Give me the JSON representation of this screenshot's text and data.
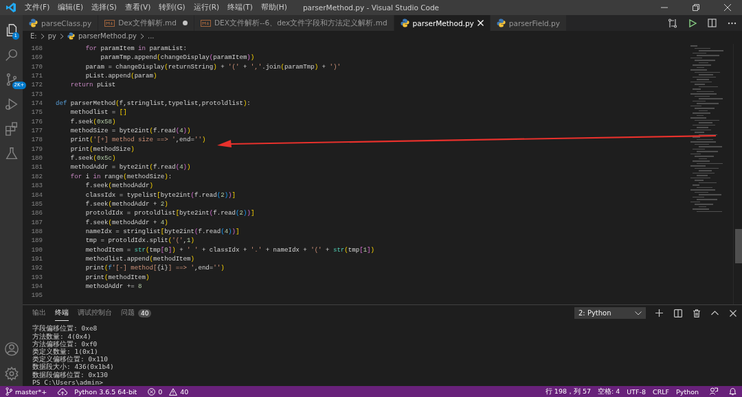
{
  "window": {
    "title": "parserMethod.py - Visual Studio Code"
  },
  "menu": [
    "文件(F)",
    "编辑(E)",
    "选择(S)",
    "查看(V)",
    "转到(G)",
    "运行(R)",
    "终端(T)",
    "帮助(H)"
  ],
  "activity_bar": [
    {
      "kind": "explorer",
      "badge": "1"
    },
    {
      "kind": "search"
    },
    {
      "kind": "source-control",
      "badge": "2K+"
    },
    {
      "kind": "run"
    },
    {
      "kind": "extensions"
    },
    {
      "kind": "testing"
    }
  ],
  "tabs": [
    {
      "label": "parseClass.py",
      "kind": "python",
      "selected": false,
      "modified": false
    },
    {
      "label": "Dex文件解析.md",
      "kind": "markdown",
      "selected": false,
      "modified": true
    },
    {
      "label": "DEX文件解析--6、dex文件字段和方法定义解析.md",
      "kind": "markdown",
      "selected": false,
      "modified": false
    },
    {
      "label": "parserMethod.py",
      "kind": "python",
      "selected": true,
      "modified": false
    },
    {
      "label": "parserField.py",
      "kind": "python",
      "selected": false,
      "modified": false
    }
  ],
  "breadcrumbs": [
    {
      "text": "E:",
      "kind": "folder"
    },
    {
      "text": "py",
      "kind": "folder"
    },
    {
      "text": "parserMethod.py",
      "kind": "python"
    },
    {
      "text": "...",
      "kind": "symbol"
    }
  ],
  "editor": {
    "lines": [
      {
        "number": "168",
        "tokens": [
          {
            "kind": "control",
            "text": "        for"
          },
          {
            "kind": "plain",
            "text": " paramItem "
          },
          {
            "kind": "control",
            "text": "in"
          },
          {
            "kind": "plain",
            "text": " paramList:"
          }
        ]
      },
      {
        "number": "169",
        "tokens": [
          {
            "kind": "plain",
            "text": "            paramTmp.append"
          },
          {
            "kind": "paren1",
            "text": "("
          },
          {
            "kind": "plain",
            "text": "changeDisplay"
          },
          {
            "kind": "paren2",
            "text": "("
          },
          {
            "kind": "plain",
            "text": "paramItem"
          },
          {
            "kind": "paren2",
            "text": ")"
          },
          {
            "kind": "paren1",
            "text": ")"
          }
        ]
      },
      {
        "number": "170",
        "tokens": [
          {
            "kind": "plain",
            "text": "        param = changeDisplay"
          },
          {
            "kind": "paren1",
            "text": "("
          },
          {
            "kind": "plain",
            "text": "returnString"
          },
          {
            "kind": "paren1",
            "text": ")"
          },
          {
            "kind": "plain",
            "text": " + "
          },
          {
            "kind": "string",
            "text": "'('"
          },
          {
            "kind": "plain",
            "text": " + "
          },
          {
            "kind": "string",
            "text": "','"
          },
          {
            "kind": "plain",
            "text": ".join"
          },
          {
            "kind": "paren1",
            "text": "("
          },
          {
            "kind": "plain",
            "text": "paramTmp"
          },
          {
            "kind": "paren1",
            "text": ")"
          },
          {
            "kind": "plain",
            "text": " + "
          },
          {
            "kind": "string",
            "text": "')'"
          }
        ]
      },
      {
        "number": "171",
        "tokens": [
          {
            "kind": "plain",
            "text": "        pList.append"
          },
          {
            "kind": "paren1",
            "text": "("
          },
          {
            "kind": "plain",
            "text": "param"
          },
          {
            "kind": "paren1",
            "text": ")"
          }
        ]
      },
      {
        "number": "172",
        "tokens": [
          {
            "kind": "control",
            "text": "    return"
          },
          {
            "kind": "plain",
            "text": " pList"
          }
        ]
      },
      {
        "number": "173"
      },
      {
        "number": "174",
        "tokens": [
          {
            "kind": "storage",
            "text": "def"
          },
          {
            "kind": "plain",
            "text": " parserMethod"
          },
          {
            "kind": "paren1",
            "text": "("
          },
          {
            "kind": "plain",
            "text": "f,stringlist,typelist,protoldlist"
          },
          {
            "kind": "paren1",
            "text": ")"
          },
          {
            "kind": "plain",
            "text": ":"
          }
        ]
      },
      {
        "number": "175",
        "tokens": [
          {
            "kind": "plain",
            "text": "    methodlist = "
          },
          {
            "kind": "paren1",
            "text": "[]"
          }
        ]
      },
      {
        "number": "176",
        "tokens": [
          {
            "kind": "plain",
            "text": "    f.seek"
          },
          {
            "kind": "paren1",
            "text": "("
          },
          {
            "kind": "number",
            "text": "0x58"
          },
          {
            "kind": "paren1",
            "text": ")"
          }
        ]
      },
      {
        "number": "177",
        "tokens": [
          {
            "kind": "plain",
            "text": "    methodSize = byte2int"
          },
          {
            "kind": "paren1",
            "text": "("
          },
          {
            "kind": "plain",
            "text": "f.read"
          },
          {
            "kind": "paren2",
            "text": "("
          },
          {
            "kind": "number",
            "text": "4"
          },
          {
            "kind": "paren2",
            "text": ")"
          },
          {
            "kind": "paren1",
            "text": ")"
          }
        ]
      },
      {
        "number": "178",
        "tokens": [
          {
            "kind": "plain",
            "text": "    print"
          },
          {
            "kind": "paren1",
            "text": "("
          },
          {
            "kind": "string",
            "text": "'[+] method size ==> '"
          },
          {
            "kind": "plain",
            "text": ",end="
          },
          {
            "kind": "string",
            "text": "''"
          },
          {
            "kind": "paren1",
            "text": ")"
          }
        ]
      },
      {
        "number": "179",
        "tokens": [
          {
            "kind": "plain",
            "text": "    print"
          },
          {
            "kind": "paren1",
            "text": "("
          },
          {
            "kind": "plain",
            "text": "methodSize"
          },
          {
            "kind": "paren1",
            "text": ")"
          }
        ]
      },
      {
        "number": "180",
        "tokens": [
          {
            "kind": "plain",
            "text": "    f.seek"
          },
          {
            "kind": "paren1",
            "text": "("
          },
          {
            "kind": "number",
            "text": "0x5c"
          },
          {
            "kind": "paren1",
            "text": ")"
          }
        ]
      },
      {
        "number": "181",
        "tokens": [
          {
            "kind": "plain",
            "text": "    methodAddr = byte2int"
          },
          {
            "kind": "paren1",
            "text": "("
          },
          {
            "kind": "plain",
            "text": "f.read"
          },
          {
            "kind": "paren2",
            "text": "("
          },
          {
            "kind": "number",
            "text": "4"
          },
          {
            "kind": "paren2",
            "text": ")"
          },
          {
            "kind": "paren1",
            "text": ")"
          }
        ]
      },
      {
        "number": "182",
        "tokens": [
          {
            "kind": "control",
            "text": "    for"
          },
          {
            "kind": "plain",
            "text": " i "
          },
          {
            "kind": "control",
            "text": "in"
          },
          {
            "kind": "plain",
            "text": " range"
          },
          {
            "kind": "paren1",
            "text": "("
          },
          {
            "kind": "plain",
            "text": "methodSize"
          },
          {
            "kind": "paren1",
            "text": ")"
          },
          {
            "kind": "plain",
            "text": ":"
          }
        ]
      },
      {
        "number": "183",
        "tokens": [
          {
            "kind": "plain",
            "text": "        f.seek"
          },
          {
            "kind": "paren1",
            "text": "("
          },
          {
            "kind": "plain",
            "text": "methodAddr"
          },
          {
            "kind": "paren1",
            "text": ")"
          }
        ]
      },
      {
        "number": "184",
        "tokens": [
          {
            "kind": "plain",
            "text": "        classIdx = typelist"
          },
          {
            "kind": "paren1",
            "text": "["
          },
          {
            "kind": "plain",
            "text": "byte2int"
          },
          {
            "kind": "paren2",
            "text": "("
          },
          {
            "kind": "plain",
            "text": "f.read"
          },
          {
            "kind": "paren3",
            "text": "("
          },
          {
            "kind": "number",
            "text": "2"
          },
          {
            "kind": "paren3",
            "text": ")"
          },
          {
            "kind": "paren2",
            "text": ")"
          },
          {
            "kind": "paren1",
            "text": "]"
          }
        ]
      },
      {
        "number": "185",
        "tokens": [
          {
            "kind": "plain",
            "text": "        f.seek"
          },
          {
            "kind": "paren1",
            "text": "("
          },
          {
            "kind": "plain",
            "text": "methodAddr + "
          },
          {
            "kind": "number",
            "text": "2"
          },
          {
            "kind": "paren1",
            "text": ")"
          }
        ]
      },
      {
        "number": "186",
        "tokens": [
          {
            "kind": "plain",
            "text": "        protoldIdx = protoldlist"
          },
          {
            "kind": "paren1",
            "text": "["
          },
          {
            "kind": "plain",
            "text": "byte2int"
          },
          {
            "kind": "paren2",
            "text": "("
          },
          {
            "kind": "plain",
            "text": "f.read"
          },
          {
            "kind": "paren3",
            "text": "("
          },
          {
            "kind": "number",
            "text": "2"
          },
          {
            "kind": "paren3",
            "text": ")"
          },
          {
            "kind": "paren2",
            "text": ")"
          },
          {
            "kind": "paren1",
            "text": "]"
          }
        ]
      },
      {
        "number": "187",
        "tokens": [
          {
            "kind": "plain",
            "text": "        f.seek"
          },
          {
            "kind": "paren1",
            "text": "("
          },
          {
            "kind": "plain",
            "text": "methodAddr + "
          },
          {
            "kind": "number",
            "text": "4"
          },
          {
            "kind": "paren1",
            "text": ")"
          }
        ]
      },
      {
        "number": "188",
        "tokens": [
          {
            "kind": "plain",
            "text": "        nameIdx = stringlist"
          },
          {
            "kind": "paren1",
            "text": "["
          },
          {
            "kind": "plain",
            "text": "byte2int"
          },
          {
            "kind": "paren2",
            "text": "("
          },
          {
            "kind": "plain",
            "text": "f.read"
          },
          {
            "kind": "paren3",
            "text": "("
          },
          {
            "kind": "number",
            "text": "4"
          },
          {
            "kind": "paren3",
            "text": ")"
          },
          {
            "kind": "paren2",
            "text": ")"
          },
          {
            "kind": "paren1",
            "text": "]"
          }
        ]
      },
      {
        "number": "189",
        "tokens": [
          {
            "kind": "plain",
            "text": "        tmp = protoldIdx.split"
          },
          {
            "kind": "paren1",
            "text": "("
          },
          {
            "kind": "string",
            "text": "'('"
          },
          {
            "kind": "plain",
            "text": ","
          },
          {
            "kind": "number",
            "text": "1"
          },
          {
            "kind": "paren1",
            "text": ")"
          }
        ]
      },
      {
        "number": "190",
        "tokens": [
          {
            "kind": "plain",
            "text": "        methodItem = "
          },
          {
            "kind": "builtin",
            "text": "str"
          },
          {
            "kind": "paren1",
            "text": "("
          },
          {
            "kind": "plain",
            "text": "tmp"
          },
          {
            "kind": "paren2",
            "text": "["
          },
          {
            "kind": "number",
            "text": "0"
          },
          {
            "kind": "paren2",
            "text": "]"
          },
          {
            "kind": "paren1",
            "text": ")"
          },
          {
            "kind": "plain",
            "text": " + "
          },
          {
            "kind": "string",
            "text": "' '"
          },
          {
            "kind": "plain",
            "text": " + classIdx + "
          },
          {
            "kind": "string",
            "text": "'.'"
          },
          {
            "kind": "plain",
            "text": " + nameIdx + "
          },
          {
            "kind": "string",
            "text": "'('"
          },
          {
            "kind": "plain",
            "text": " + "
          },
          {
            "kind": "builtin",
            "text": "str"
          },
          {
            "kind": "paren1",
            "text": "("
          },
          {
            "kind": "plain",
            "text": "tmp"
          },
          {
            "kind": "paren2",
            "text": "["
          },
          {
            "kind": "number",
            "text": "1"
          },
          {
            "kind": "paren2",
            "text": "]"
          },
          {
            "kind": "paren1",
            "text": ")"
          }
        ]
      },
      {
        "number": "191",
        "tokens": [
          {
            "kind": "plain",
            "text": "        methodlist.append"
          },
          {
            "kind": "paren1",
            "text": "("
          },
          {
            "kind": "plain",
            "text": "methodItem"
          },
          {
            "kind": "paren1",
            "text": ")"
          }
        ]
      },
      {
        "number": "192",
        "tokens": [
          {
            "kind": "plain",
            "text": "        print"
          },
          {
            "kind": "paren1",
            "text": "("
          },
          {
            "kind": "storage",
            "text": "f"
          },
          {
            "kind": "string",
            "text": "'[-] method["
          },
          {
            "kind": "plain",
            "text": "{i}"
          },
          {
            "kind": "string",
            "text": "] ==> '"
          },
          {
            "kind": "plain",
            "text": ",end="
          },
          {
            "kind": "string",
            "text": "''"
          },
          {
            "kind": "paren1",
            "text": ")"
          }
        ]
      },
      {
        "number": "193",
        "tokens": [
          {
            "kind": "plain",
            "text": "        print"
          },
          {
            "kind": "paren1",
            "text": "("
          },
          {
            "kind": "plain",
            "text": "methodItem"
          },
          {
            "kind": "paren1",
            "text": ")"
          }
        ]
      },
      {
        "number": "194",
        "tokens": [
          {
            "kind": "plain",
            "text": "        methodAddr += "
          },
          {
            "kind": "number",
            "text": "8"
          }
        ]
      },
      {
        "number": "195"
      }
    ]
  },
  "panel": {
    "tabs": [
      {
        "label": "输出",
        "selected": false
      },
      {
        "label": "终端",
        "selected": true
      },
      {
        "label": "调试控制台",
        "selected": false
      },
      {
        "label": "问题",
        "selected": false,
        "badge": "40"
      }
    ],
    "terminal_select": "2: Python",
    "terminal_lines": [
      "字段偏移位置: 0xe8",
      "方法数量: 4(0x4)",
      "方法偏移位置: 0xf0",
      "类定义数量: 1(0x1)",
      "类定义偏移位置: 0x110",
      "数据段大小: 436(0x1b4)",
      "数据段偏移位置: 0x130",
      "PS C:\\Users\\admin>"
    ]
  },
  "status_bar": {
    "branch": "master*+",
    "interpreter": "Python 3.6.5 64-bit",
    "errors": "0",
    "warnings": "40",
    "position": "行 198，列 57",
    "indentation": "空格: 4",
    "encoding": "UTF-8",
    "line_ending": "CRLF",
    "language": "Python"
  }
}
